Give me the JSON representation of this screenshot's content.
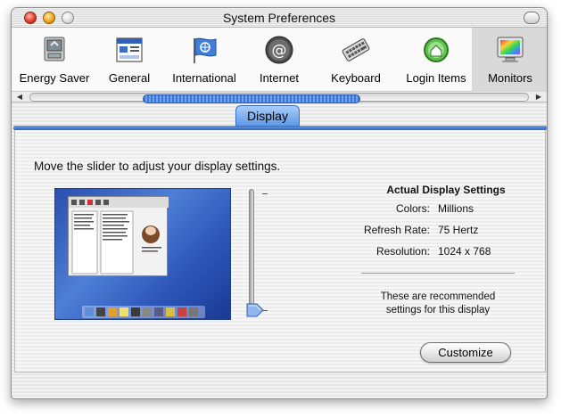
{
  "window": {
    "title": "System Preferences"
  },
  "toolbar": {
    "items": [
      {
        "label": "Energy Saver",
        "icon": "energy-saver-icon"
      },
      {
        "label": "General",
        "icon": "general-icon"
      },
      {
        "label": "International",
        "icon": "international-flag-icon"
      },
      {
        "label": "Internet",
        "icon": "internet-at-icon"
      },
      {
        "label": "Keyboard",
        "icon": "keyboard-icon"
      },
      {
        "label": "Login Items",
        "icon": "login-items-icon"
      },
      {
        "label": "Monitors",
        "icon": "monitors-icon"
      }
    ],
    "selected": "Monitors"
  },
  "tabs": {
    "active": "Display"
  },
  "display": {
    "instruction": "Move the slider to adjust your display settings.",
    "settings_title": "Actual Display Settings",
    "rows": [
      {
        "label": "Colors:",
        "value": "Millions"
      },
      {
        "label": "Refresh Rate:",
        "value": "75 Hertz"
      },
      {
        "label": "Resolution:",
        "value": "1024 x 768"
      }
    ],
    "recommendation_line1": "These are recommended",
    "recommendation_line2": "settings for this display",
    "customize_label": "Customize",
    "slider_level": 0
  },
  "colors": {
    "accent_blue": "#3d78d8",
    "tab_blue": "#5e9ae8"
  }
}
